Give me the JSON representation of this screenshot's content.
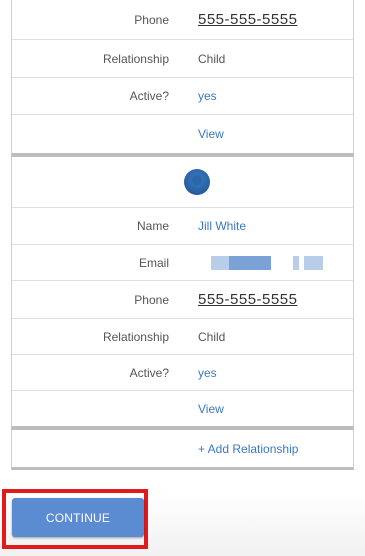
{
  "relationship_1": {
    "phone_label": "Phone",
    "phone_value": "555-555-5555",
    "relationship_label": "Relationship",
    "relationship_value": "Child",
    "active_label": "Active?",
    "active_value": "yes",
    "view_link": "View"
  },
  "relationship_2": {
    "name_label": "Name",
    "name_value": "Jill White",
    "email_label": "Email",
    "phone_label": "Phone",
    "phone_value": "555-555-5555",
    "relationship_label": "Relationship",
    "relationship_value": "Child",
    "active_label": "Active?",
    "active_value": "yes",
    "view_link": "View",
    "avatar_icon": "user-avatar-icon"
  },
  "add_relationship_link": "+ Add Relationship",
  "continue_button": "CONTINUE",
  "colors": {
    "link": "#3b78c2",
    "button": "#5b8bd0",
    "highlight": "#e01b1b"
  }
}
